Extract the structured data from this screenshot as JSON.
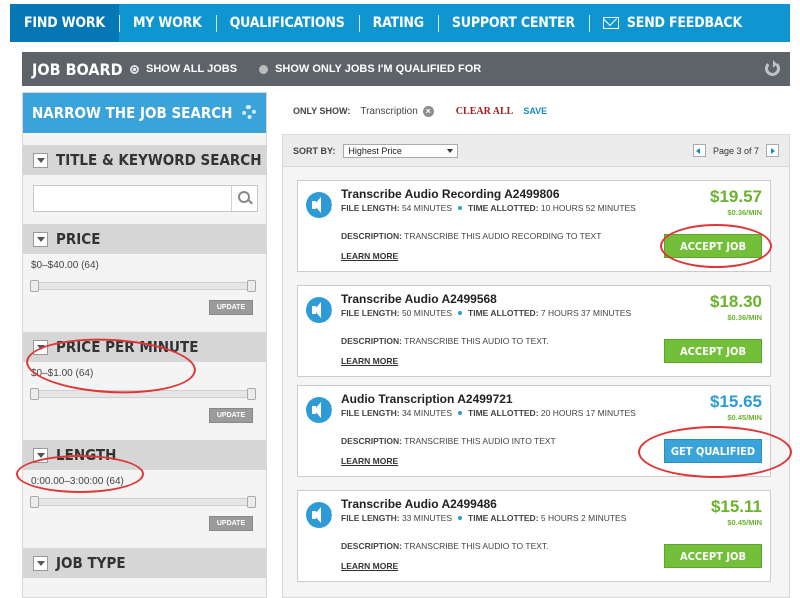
{
  "nav": {
    "items": [
      {
        "label": "FIND WORK"
      },
      {
        "label": "MY WORK"
      },
      {
        "label": "QUALIFICATIONS"
      },
      {
        "label": "RATING"
      },
      {
        "label": "SUPPORT CENTER"
      },
      {
        "label": "SEND FEEDBACK"
      }
    ]
  },
  "jobboard": {
    "title": "JOB BOARD",
    "option_all": "SHOW ALL JOBS",
    "option_qualified": "SHOW ONLY JOBS I'M QUALIFIED FOR"
  },
  "sidebar": {
    "title": "NARROW THE JOB SEARCH",
    "keyword": {
      "header": "TITLE & KEYWORD SEARCH",
      "value": "",
      "placeholder": ""
    },
    "price": {
      "header": "PRICE",
      "range": "$0–$40.00",
      "count": "(64)",
      "update": "UPDATE"
    },
    "ppm": {
      "header": "PRICE PER MINUTE",
      "range": "$0–$1.00",
      "count": "(64)",
      "update": "UPDATE"
    },
    "length": {
      "header": "LENGTH",
      "range": "0:00.00–3:00:00",
      "count": "(64)",
      "update": "UPDATE"
    },
    "jobtype": {
      "header": "JOB TYPE"
    }
  },
  "filterbar": {
    "label": "ONLY SHOW:",
    "chip": "Transcription",
    "clear_all": "CLEAR ALL",
    "save": "SAVE"
  },
  "sort": {
    "label": "SORT BY:",
    "selected": "Highest Price",
    "page_text": "Page 3 of 7"
  },
  "jobs": [
    {
      "title": "Transcribe Audio Recording A2499806",
      "file_label": "FILE LENGTH:",
      "file_value": "54 MINUTES",
      "time_label": "TIME ALLOTTED:",
      "time_value": "10 HOURS 52 MINUTES",
      "desc_label": "DESCRIPTION:",
      "desc_value": "TRANSCRIBE THIS AUDIO RECORDING TO TEXT",
      "learn": "LEARN MORE",
      "price": "$19.57",
      "rate": "$0.36/MIN",
      "button": "ACCEPT JOB"
    },
    {
      "title": "Transcribe Audio A2499568",
      "file_label": "FILE LENGTH:",
      "file_value": "50 MINUTES",
      "time_label": "TIME ALLOTTED:",
      "time_value": "7 HOURS 37 MINUTES",
      "desc_label": "DESCRIPTION:",
      "desc_value": "TRANSCRIBE THIS AUDIO TO TEXT.",
      "learn": "LEARN MORE",
      "price": "$18.30",
      "rate": "$0.36/MIN",
      "button": "ACCEPT JOB"
    },
    {
      "title": "Audio Transcription A2499721",
      "file_label": "FILE LENGTH:",
      "file_value": "34 MINUTES",
      "time_label": "TIME ALLOTTED:",
      "time_value": "20 HOURS 17 MINUTES",
      "desc_label": "DESCRIPTION:",
      "desc_value": "TRANSCRIBE THIS AUDIO INTO TEXT",
      "learn": "LEARN MORE",
      "price": "$15.65",
      "rate": "$0.45/MIN",
      "button": "GET QUALIFIED"
    },
    {
      "title": "Transcribe Audio A2499486",
      "file_label": "FILE LENGTH:",
      "file_value": "33 MINUTES",
      "time_label": "TIME ALLOTTED:",
      "time_value": "5 HOURS 2 MINUTES",
      "desc_label": "DESCRIPTION:",
      "desc_value": "TRANSCRIBE THIS AUDIO TO TEXT.",
      "learn": "LEARN MORE",
      "price": "$15.11",
      "rate": "$0.45/MIN",
      "button": "ACCEPT JOB"
    }
  ],
  "colors": {
    "nav_blue": "#0f96d1",
    "accept_green": "#74bf3a",
    "qualify_blue": "#3aa3d9",
    "highlight_red": "#e03535"
  }
}
